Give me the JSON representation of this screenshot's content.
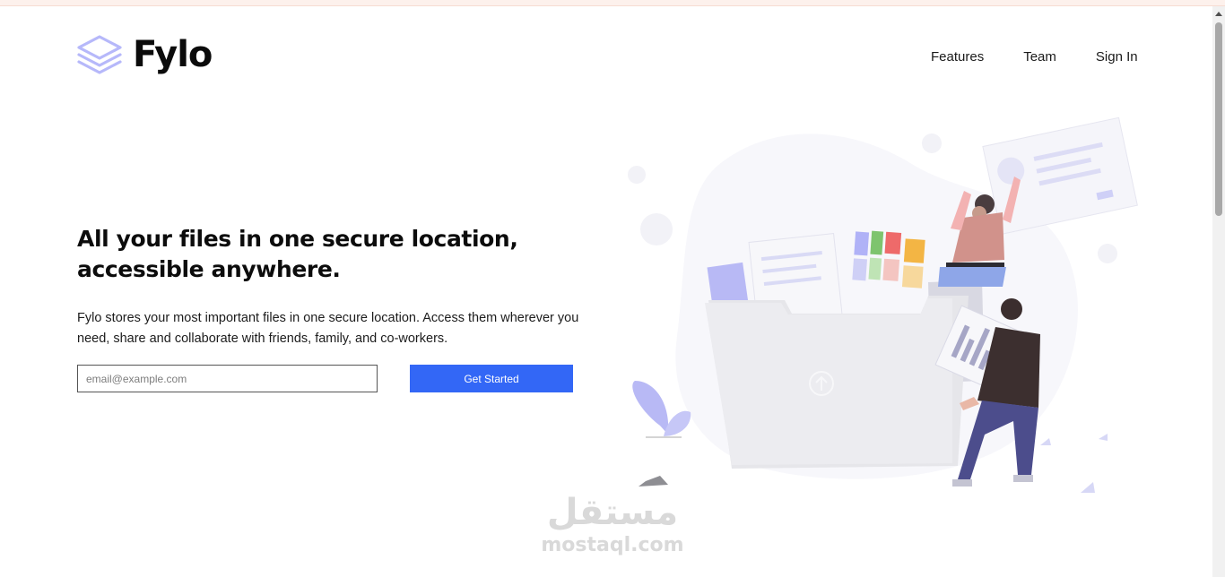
{
  "header": {
    "brand": "Fylo",
    "logo_icon": "stacked-layers-icon",
    "nav": [
      {
        "label": "Features"
      },
      {
        "label": "Team"
      },
      {
        "label": "Sign In"
      }
    ]
  },
  "hero": {
    "title_line1": "All your files in one secure location,",
    "title_line2": "accessible anywhere.",
    "description": "Fylo stores your most important files in one secure location. Access them wherever you need, share and collaborate with friends, family, and co-workers.",
    "email_placeholder": "email@example.com",
    "email_value": "",
    "cta_label": "Get Started"
  },
  "illustration": {
    "icon": "file-upload-illustration"
  },
  "watermark": {
    "arabic": "مستقل",
    "latin": "mostaql.com"
  },
  "colors": {
    "accent": "#3367f6",
    "logo": "#b6b8fa",
    "text": "#0c0c0c"
  }
}
